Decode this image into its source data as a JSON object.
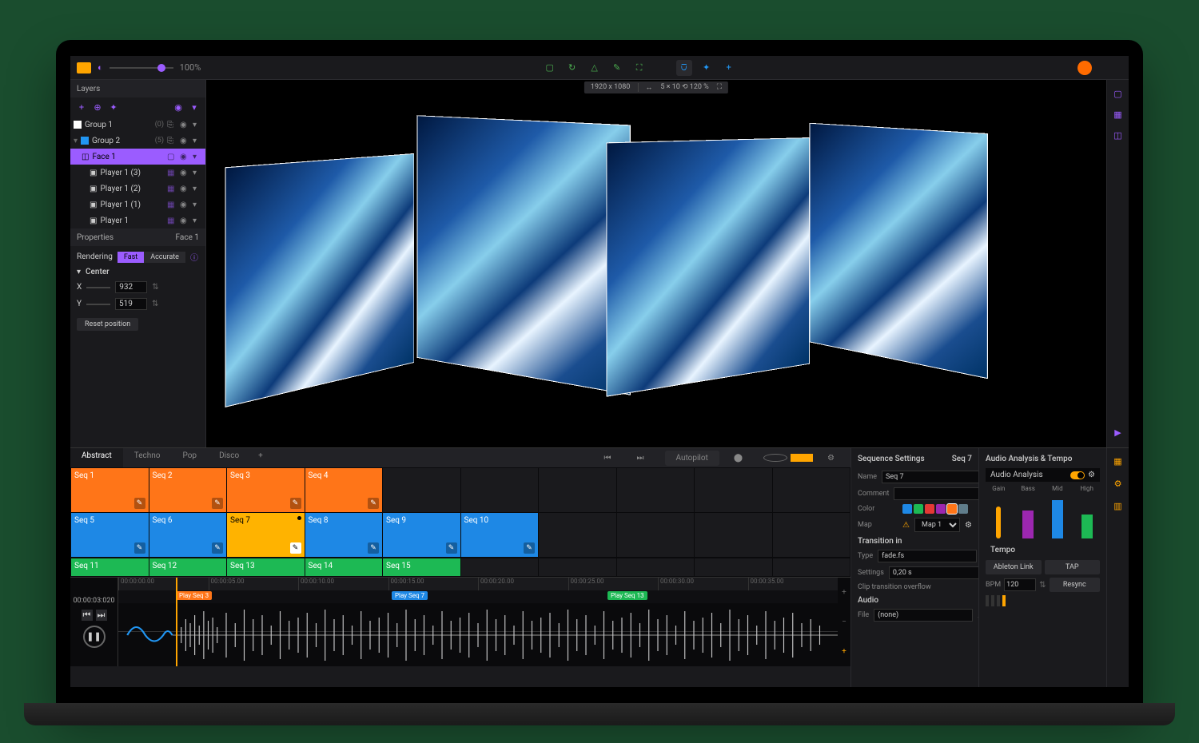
{
  "topbar": {
    "zoom_pct": "100%",
    "resolution": "1920 x 1080",
    "grid_info": "5 × 10 ⟲ 120 %"
  },
  "layers": {
    "title": "Layers",
    "items": [
      {
        "name": "Group 1",
        "count": "(0)"
      },
      {
        "name": "Group 2",
        "count": "(5)"
      },
      {
        "name": "Face 1"
      },
      {
        "name": "Player 1 (3)"
      },
      {
        "name": "Player 1 (2)"
      },
      {
        "name": "Player 1 (1)"
      },
      {
        "name": "Player 1"
      }
    ]
  },
  "properties": {
    "title": "Properties",
    "target": "Face 1",
    "rendering_label": "Rendering",
    "rendering_fast": "Fast",
    "rendering_accurate": "Accurate",
    "center_label": "Center",
    "x_label": "X",
    "x_value": "932",
    "y_label": "Y",
    "y_value": "519",
    "reset_btn": "Reset position"
  },
  "tabs": {
    "items": [
      "Abstract",
      "Techno",
      "Pop",
      "Disco"
    ],
    "autopilot": "Autopilot"
  },
  "sequences": {
    "row1": [
      "Seq 1",
      "Seq 2",
      "Seq 3",
      "Seq 4"
    ],
    "row2": [
      "Seq 5",
      "Seq 6",
      "Seq 7",
      "Seq 8",
      "Seq 9",
      "Seq 10"
    ],
    "row3": [
      "Seq 11",
      "Seq 12",
      "Seq 13",
      "Seq 14",
      "Seq 15"
    ]
  },
  "timeline": {
    "timecode": "00:00:03:020",
    "ticks": [
      "00:00:00.00",
      "00:00:05.00",
      "00:00:10.00",
      "00:00:15.00",
      "00:00:20.00",
      "00:00:25.00",
      "00:00:30.00",
      "00:00:35.00"
    ],
    "markers": [
      {
        "label": "Play Seq 3",
        "color": "o",
        "pos": 8
      },
      {
        "label": "Play Seq 7",
        "color": "b",
        "pos": 38
      },
      {
        "label": "Play Seq 13",
        "color": "g",
        "pos": 68
      }
    ]
  },
  "seq_settings": {
    "title": "Sequence Settings",
    "target": "Seq 7",
    "name_label": "Name",
    "name_value": "Seq 7",
    "comment_label": "Comment",
    "color_label": "Color",
    "colors": [
      "#1e88e5",
      "#1db954",
      "#e53935",
      "#9c27b0",
      "#ff7518",
      "#607d8b"
    ],
    "map_label": "Map",
    "map_value": "Map 1",
    "transition_in": "Transition in",
    "type_label": "Type",
    "type_value": "fade.fs",
    "settings_label": "Settings",
    "settings_value": "0,20 s",
    "overflow": "Clip transition overflow",
    "audio_label": "Audio",
    "file_label": "File",
    "file_value": "(none)"
  },
  "audio": {
    "title": "Audio Analysis & Tempo",
    "analysis": "Audio Analysis",
    "bands": {
      "gain": "Gain",
      "bass": "Bass",
      "mid": "Mid",
      "high": "High"
    },
    "tempo_label": "Tempo",
    "ableton": "Ableton Link",
    "tap": "TAP",
    "bpm_label": "BPM",
    "bpm_value": "120",
    "resync": "Resync"
  }
}
